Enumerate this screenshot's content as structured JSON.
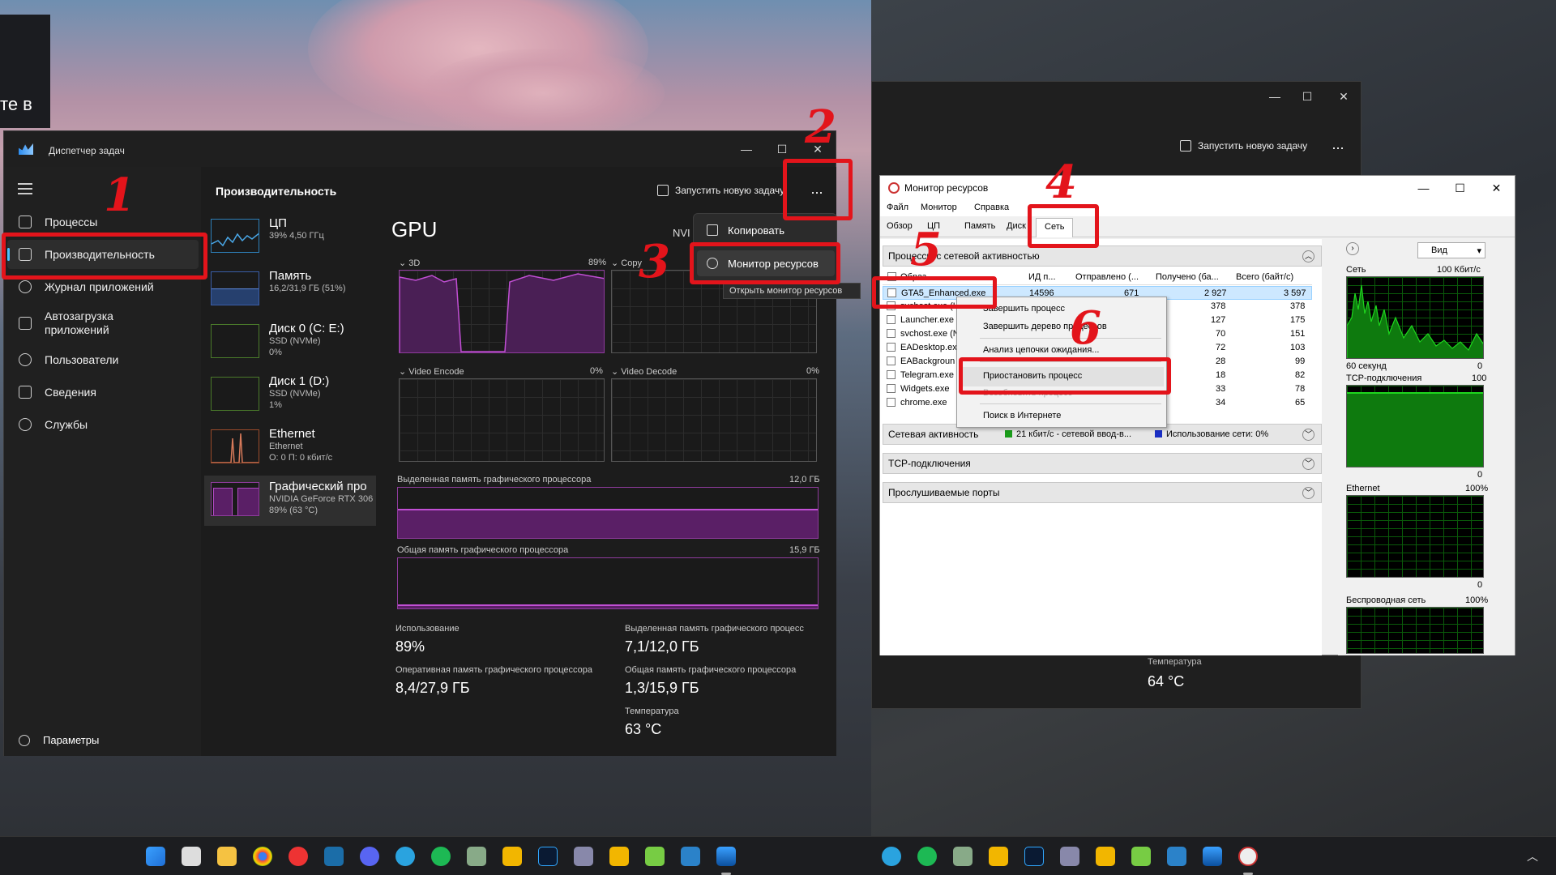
{
  "left_edge_text": "те в",
  "task_manager": {
    "title": "Диспетчер задач",
    "nav": [
      {
        "label": "Процессы",
        "icon": "grid-icon"
      },
      {
        "label": "Производительность",
        "icon": "performance-icon"
      },
      {
        "label": "Журнал приложений",
        "icon": "history-icon"
      },
      {
        "label": "Автозагрузка приложений",
        "icon": "startup-icon"
      },
      {
        "label": "Пользователи",
        "icon": "users-icon"
      },
      {
        "label": "Сведения",
        "icon": "list-icon"
      },
      {
        "label": "Службы",
        "icon": "services-icon"
      }
    ],
    "settings_label": "Параметры",
    "header": "Производительность",
    "new_task_label": "Запустить новую задачу",
    "more_label": "...",
    "resources": [
      {
        "name": "ЦП",
        "line1": "39% 4,50 ГГц",
        "line2": ""
      },
      {
        "name": "Память",
        "line1": "16,2/31,9 ГБ (51%)",
        "line2": ""
      },
      {
        "name": "Диск 0 (C: E:)",
        "line1": "SSD (NVMe)",
        "line2": "0%"
      },
      {
        "name": "Диск 1 (D:)",
        "line1": "SSD (NVMe)",
        "line2": "1%"
      },
      {
        "name": "Ethernet",
        "line1": "Ethernet",
        "line2": "О: 0 П: 0 кбит/с"
      },
      {
        "name": "Графический про",
        "line1": "NVIDIA GeForce RTX 306",
        "line2": "89% (63 °C)"
      }
    ],
    "gpu_title": "GPU",
    "gpu_model": "NVI",
    "graphs": {
      "g3d": "3D",
      "g3d_pct": "89%",
      "copy": "Copy",
      "venc": "Video Encode",
      "venc_pct": "0%",
      "vdec": "Video Decode",
      "vdec_pct": "0%",
      "dedicated": "Выделенная память графического процессора",
      "dedicated_max": "12,0 ГБ",
      "shared": "Общая память графического процессора",
      "shared_max": "15,9 ГБ"
    },
    "stats": {
      "usage_label": "Использование",
      "usage_val": "89%",
      "ded_label": "Выделенная память графического процесс",
      "ded_val": "7,1/12,0 ГБ",
      "ram_label": "Оперативная память графического процессора",
      "ram_val": "8,4/27,9 ГБ",
      "shared_label": "Общая память графического процессора",
      "shared_val": "1,3/15,9 ГБ",
      "temp_label": "Температура",
      "temp_val": "63 °C"
    },
    "menu": {
      "copy": "Копировать",
      "resmon": "Монитор ресурсов",
      "tooltip": "Открыть монитор ресурсов"
    }
  },
  "bg_task_manager": {
    "new_task_label": "Запустить новую задачу",
    "more_label": "...",
    "temp_label": "Температура",
    "temp_val": "64 °C"
  },
  "resource_monitor": {
    "title": "Монитор ресурсов",
    "menus": [
      "Файл",
      "Монитор",
      "Справка"
    ],
    "tabs": [
      "Обзор",
      "ЦП",
      "Память",
      "Диск",
      "Сеть"
    ],
    "section_processes": "Процессы с сетевой активностью",
    "columns": [
      "Образ",
      "ИД п...",
      "Отправлено (...",
      "Получено (ба...",
      "Всего (байт/с)"
    ],
    "rows": [
      {
        "name": "GTA5_Enhanced.exe",
        "pid": "14596",
        "sent": "671",
        "recv": "2 927",
        "total": "3 597"
      },
      {
        "name": "svchost.exe (L",
        "pid": "",
        "sent": "",
        "recv": "378",
        "total": "378"
      },
      {
        "name": "Launcher.exe",
        "pid": "",
        "sent": "",
        "recv": "127",
        "total": "175"
      },
      {
        "name": "svchost.exe (N",
        "pid": "",
        "sent": "",
        "recv": "70",
        "total": "151"
      },
      {
        "name": "EADesktop.ex",
        "pid": "",
        "sent": "",
        "recv": "72",
        "total": "103"
      },
      {
        "name": "EABackgroun",
        "pid": "",
        "sent": "",
        "recv": "28",
        "total": "99"
      },
      {
        "name": "Telegram.exe",
        "pid": "",
        "sent": "",
        "recv": "18",
        "total": "82"
      },
      {
        "name": "Widgets.exe",
        "pid": "",
        "sent": "",
        "recv": "33",
        "total": "78"
      },
      {
        "name": "chrome.exe",
        "pid": "",
        "sent": "",
        "recv": "34",
        "total": "65"
      }
    ],
    "section_activity": "Сетевая активность",
    "activity_io": "21 кбит/с - сетевой ввод-в...",
    "activity_usage": "Использование сети: 0%",
    "section_tcp": "TCP-подключения",
    "section_ports": "Прослушиваемые порты",
    "view_label": "Вид",
    "graphs": [
      {
        "name": "Сеть",
        "max": "100 Кбит/с",
        "bottom_left": "60 секунд",
        "bottom_right": "0"
      },
      {
        "name": "TCP-подключения",
        "max": "100",
        "bottom_left": "",
        "bottom_right": "0"
      },
      {
        "name": "Ethernet",
        "max": "100%",
        "bottom_left": "",
        "bottom_right": "0"
      },
      {
        "name": "Беспроводная сеть",
        "max": "100%",
        "bottom_left": "",
        "bottom_right": ""
      }
    ],
    "context_menu": [
      "Завершить процесс",
      "Завершить дерево процессов",
      "Анализ цепочки ожидания...",
      "Приостановить процесс",
      "Возобновить процесс",
      "Поиск в Интернете"
    ]
  },
  "annotations": [
    "1",
    "2",
    "3",
    "4",
    "5",
    "6"
  ],
  "colors": {
    "annotation": "#e3141b",
    "gpu_purple": "#8e3b9c",
    "accent": "#4cc2ff",
    "rm_graph": "#1ed61e"
  }
}
